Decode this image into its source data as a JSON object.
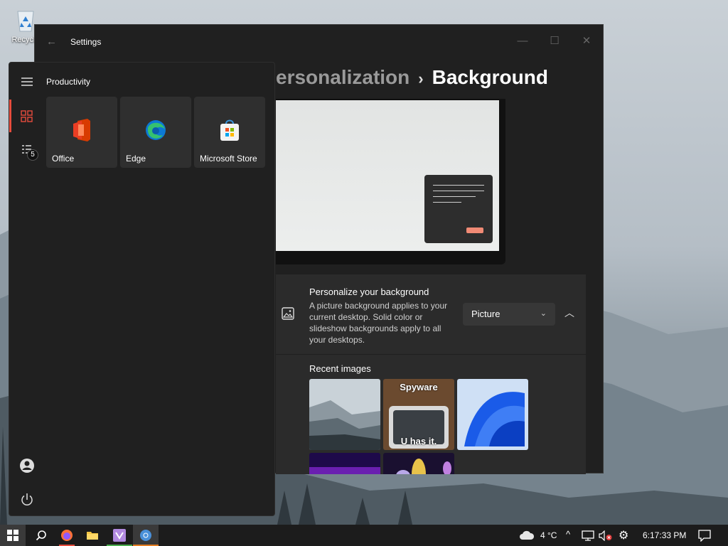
{
  "desktop": {
    "recycle_bin_label": "Recycle"
  },
  "settings": {
    "title": "Settings",
    "breadcrumb_parent": "ersonalization",
    "breadcrumb_separator": "›",
    "breadcrumb_current": "Background",
    "personalize": {
      "title": "Personalize your background",
      "description": "A picture background applies to your current desktop. Solid color or slideshow backgrounds apply to all your desktops.",
      "dropdown_value": "Picture"
    },
    "recent_images_label": "Recent images",
    "recent_images": [
      {
        "name": "mountains"
      },
      {
        "name": "spyware-meme",
        "top_text": "Spyware",
        "bottom_text": "U has it."
      },
      {
        "name": "windows-11-bloom"
      },
      {
        "name": "purple-gradient"
      },
      {
        "name": "colorful-abstract"
      }
    ]
  },
  "start_menu": {
    "group_label": "Productivity",
    "notification_count": "5",
    "tiles": [
      {
        "label": "Office",
        "icon": "office-icon"
      },
      {
        "label": "Edge",
        "icon": "edge-icon"
      },
      {
        "label": "Microsoft Store",
        "icon": "microsoft-store-icon"
      }
    ]
  },
  "taskbar": {
    "temperature": "4 °C",
    "time": "6:17:33 PM",
    "apps": [
      "start",
      "search",
      "firefox",
      "file-explorer",
      "visual-studio",
      "chrome"
    ]
  },
  "colors": {
    "accent_red": "#e74c3c",
    "window_bg": "#202020",
    "card_bg": "#2b2b2b"
  }
}
